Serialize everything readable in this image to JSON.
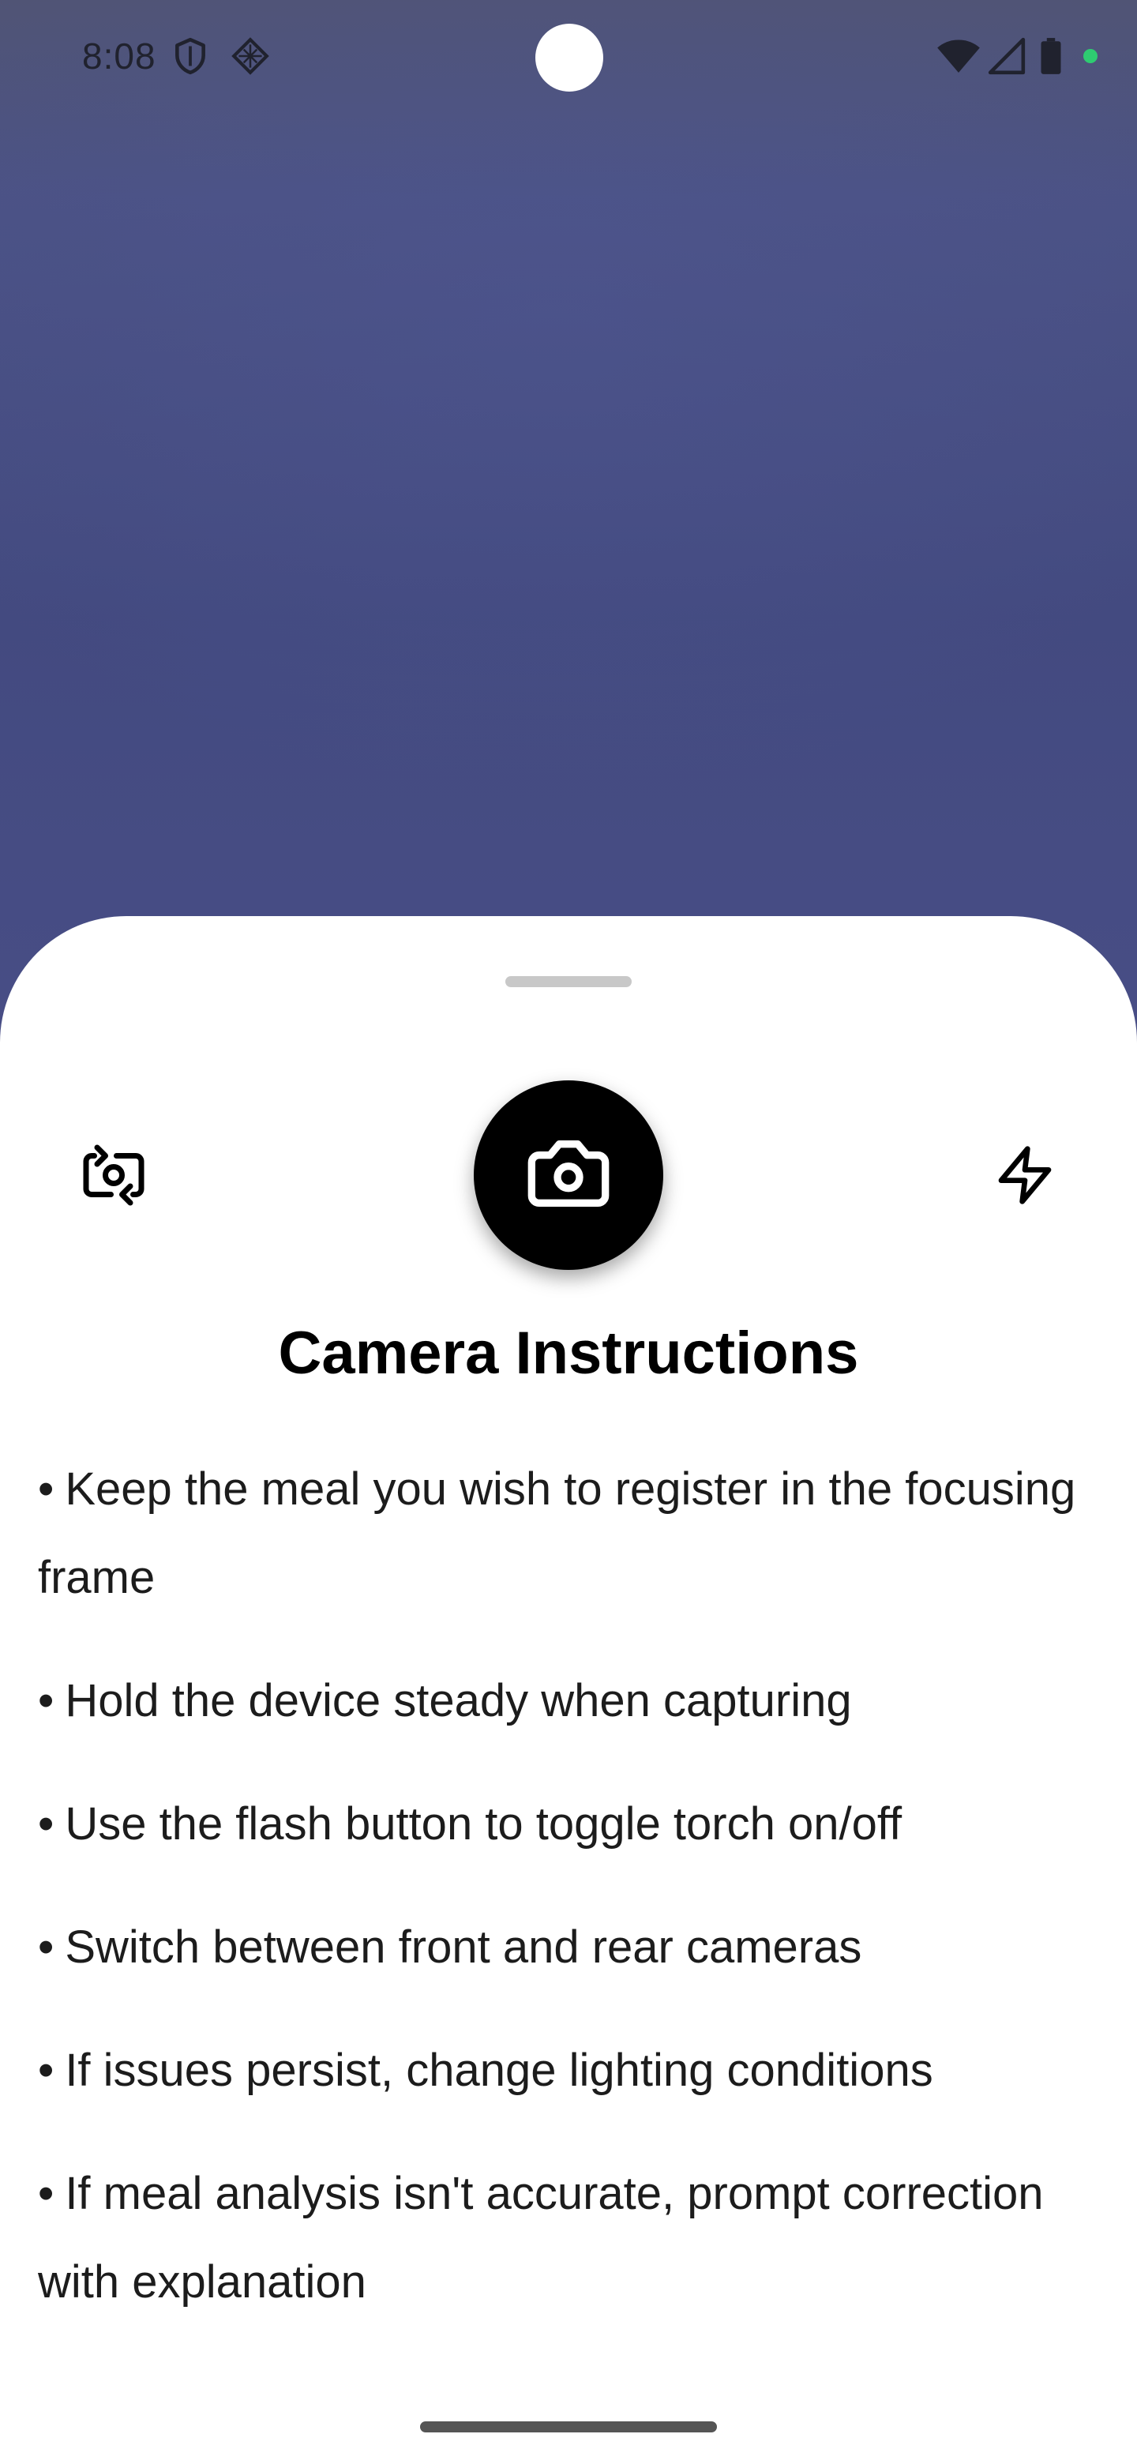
{
  "status_bar": {
    "time": "8:08",
    "left_icons": [
      "shield-icon",
      "diamond-grid-icon"
    ],
    "right_icons": [
      "wifi-icon",
      "cell-signal-icon",
      "battery-icon",
      "privacy-dot-icon"
    ],
    "privacy_dot_color": "#2ecc71"
  },
  "sheet": {
    "controls": {
      "switch_camera_icon": "switch-camera-icon",
      "capture_icon": "camera-icon",
      "flash_icon": "flash-icon"
    },
    "title": "Camera Instructions",
    "bullet": "•",
    "instructions": [
      "Keep the meal you wish to register in the focusing frame",
      "Hold the device steady when capturing",
      "Use the flash button to toggle torch on/off",
      "Switch between front and rear cameras",
      "If issues persist, change lighting conditions",
      "If meal analysis isn't accurate, prompt correction with explanation"
    ]
  },
  "colors": {
    "preview_background": "#4a5288",
    "sheet_background": "#ffffff",
    "capture_button": "#000000"
  }
}
